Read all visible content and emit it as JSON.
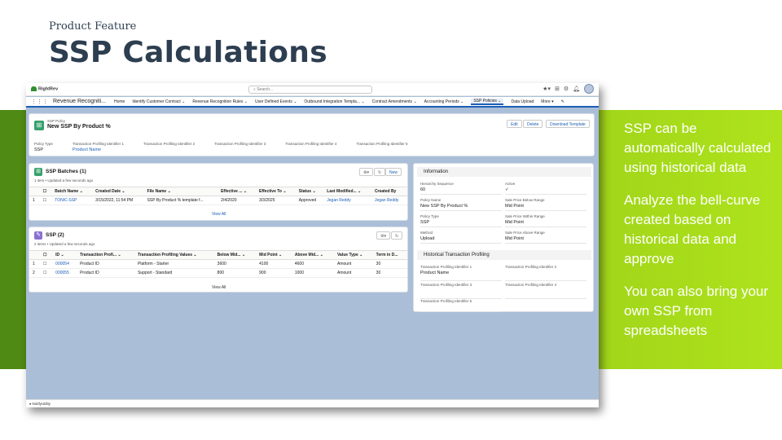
{
  "slide": {
    "eyebrow": "Product Feature",
    "title": "SSP Calculations",
    "bullets": [
      "SSP can be automatically calculated using historical data",
      "Analyze the bell-curve created based on historical data and approve",
      "You can also bring your own SSP from spreadsheets"
    ]
  },
  "colors": {
    "title": "#2d3e50",
    "band": "#9ed219",
    "brand_blue": "#1b5fb6"
  },
  "app": {
    "logo": "RightRev",
    "search_placeholder": "Search...",
    "app_name": "Revenue Recogniti...",
    "nav": [
      "Home",
      "Identify Customer Contract",
      "Revenue Recognition Rules",
      "User Defined Events",
      "Outbound Integration Templa...",
      "Contract Amendments",
      "Accounting Periods",
      "SSP Policies",
      "Data Upload",
      "More"
    ],
    "active_nav_index": 7
  },
  "record": {
    "crumb": "SSP Policy",
    "name": "New SSP By Product %",
    "buttons": [
      "Edit",
      "Delete",
      "Download Template"
    ],
    "fields": [
      {
        "label": "Policy Type",
        "value": "SSP"
      },
      {
        "label": "Transaction Profiling Identifier 1",
        "value": "Product Name"
      },
      {
        "label": "Transaction Profiling Identifier 2",
        "value": ""
      },
      {
        "label": "Transaction Profiling Identifier 3",
        "value": ""
      },
      {
        "label": "Transaction Profiling Identifier 4",
        "value": ""
      },
      {
        "label": "Transaction Profiling Identifier 5",
        "value": ""
      }
    ]
  },
  "batches": {
    "title": "SSP Batches (1)",
    "sub": "1 item • Updated a few seconds ago",
    "new_label": "New",
    "columns": [
      "",
      "",
      "Batch Name",
      "Created Date",
      "File Name",
      "Effective ...",
      "Effective To",
      "Status",
      "Last Modified...",
      "Created By"
    ],
    "rows": [
      [
        "1",
        "",
        "TONIC-SSP",
        "3/15/2022, 11:54 PM",
        "SSP By Product % template f...",
        "2/4/2020",
        "3/3/2025",
        "Approved",
        "Jegan Reddy",
        "Jegan Reddy"
      ]
    ],
    "view_all": "View All"
  },
  "ssp": {
    "title": "SSP (2)",
    "sub": "2 items • Updated a few seconds ago",
    "columns": [
      "",
      "",
      "ID",
      "Transaction Profi...",
      "Transaction Profiling Values",
      "Below Mid...",
      "Mid Point",
      "Above Mid...",
      "Value Type",
      "Term in D..."
    ],
    "rows": [
      [
        "1",
        "",
        "000054",
        "Product ID",
        "Platform - Starter",
        "3600",
        "4100",
        "4600",
        "Amount",
        "30"
      ],
      [
        "2",
        "",
        "000055",
        "Product ID",
        "Support - Standard",
        "800",
        "900",
        "1000",
        "Amount",
        "30"
      ]
    ],
    "view_all": "View All"
  },
  "information": {
    "title": "Information",
    "fields": [
      {
        "label": "Hierarchy Sequence",
        "value": "60"
      },
      {
        "label": "Active",
        "value": "✓"
      },
      {
        "label": "Policy Name",
        "value": "New SSP By Product %"
      },
      {
        "label": "Sale Price Below Range",
        "value": "Mid Point"
      },
      {
        "label": "Policy Type",
        "value": "SSP"
      },
      {
        "label": "Sale Price Within Range",
        "value": "Mid Point"
      },
      {
        "label": "Method",
        "value": "Upload"
      },
      {
        "label": "Sale Price Above Range",
        "value": "Mid Point"
      }
    ],
    "hist_title": "Historical Transaction Profiling",
    "hist_fields": [
      {
        "label": "Transaction Profiling Identifier 1",
        "value": "Product Name"
      },
      {
        "label": "Transaction Profiling Identifier 2",
        "value": ""
      },
      {
        "label": "Transaction Profiling Identifier 3",
        "value": ""
      },
      {
        "label": "Transaction Profiling Identifier 4",
        "value": ""
      },
      {
        "label": "Transaction Profiling Identifier 5",
        "value": ""
      }
    ]
  },
  "utility_bar": "NotifyUtility"
}
